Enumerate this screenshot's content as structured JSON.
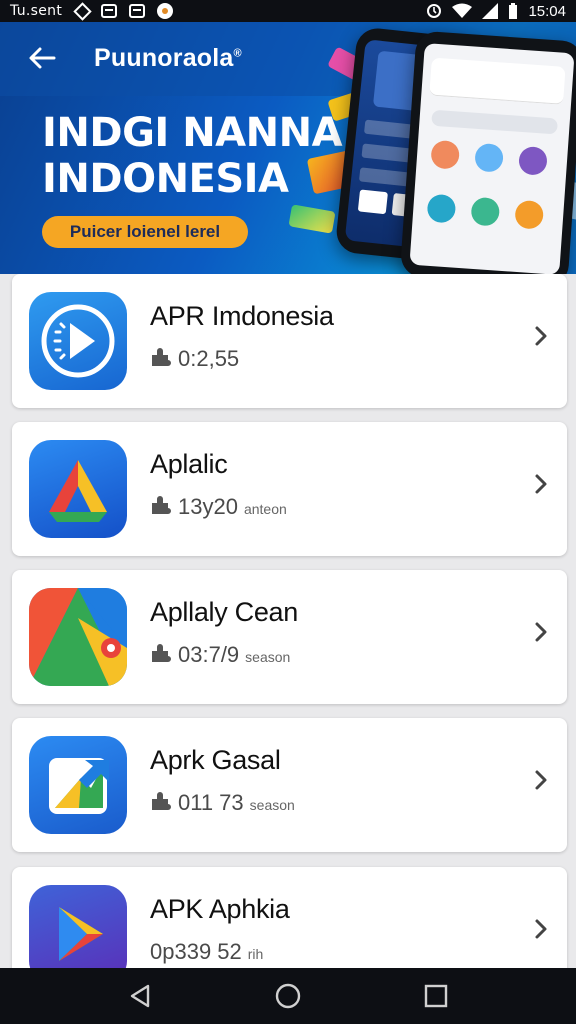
{
  "status_bar": {
    "carrier": "Tu.sent",
    "time": "15:04"
  },
  "header": {
    "title": "Puunoraola",
    "title_mark": "®"
  },
  "banner": {
    "headline_line1": "INDGI NANNA",
    "headline_line2": "INDONESIA",
    "cta_label": "Puicer loienel lerel"
  },
  "apps": [
    {
      "name": "APR Imdonesia",
      "meta": "0:2,55",
      "unit": "",
      "icon": "clock-play-icon"
    },
    {
      "name": "Aplalic",
      "meta": "13y20",
      "unit": "anteon",
      "icon": "triangle-a-icon"
    },
    {
      "name": "Apllaly Cean",
      "meta": "03:7/9",
      "unit": "season",
      "icon": "maps-triangle-icon"
    },
    {
      "name": "Aprk Gasal",
      "meta": "011 73",
      "unit": "season",
      "icon": "share-arrow-icon"
    },
    {
      "name": "APK Aphkia",
      "meta": "0p339 52",
      "unit": "rih",
      "icon": "play-store-icon"
    }
  ],
  "colors": {
    "banner_blue": "#0b5bc2",
    "cta_orange": "#f5a623",
    "system_bar": "#0d0f14"
  }
}
